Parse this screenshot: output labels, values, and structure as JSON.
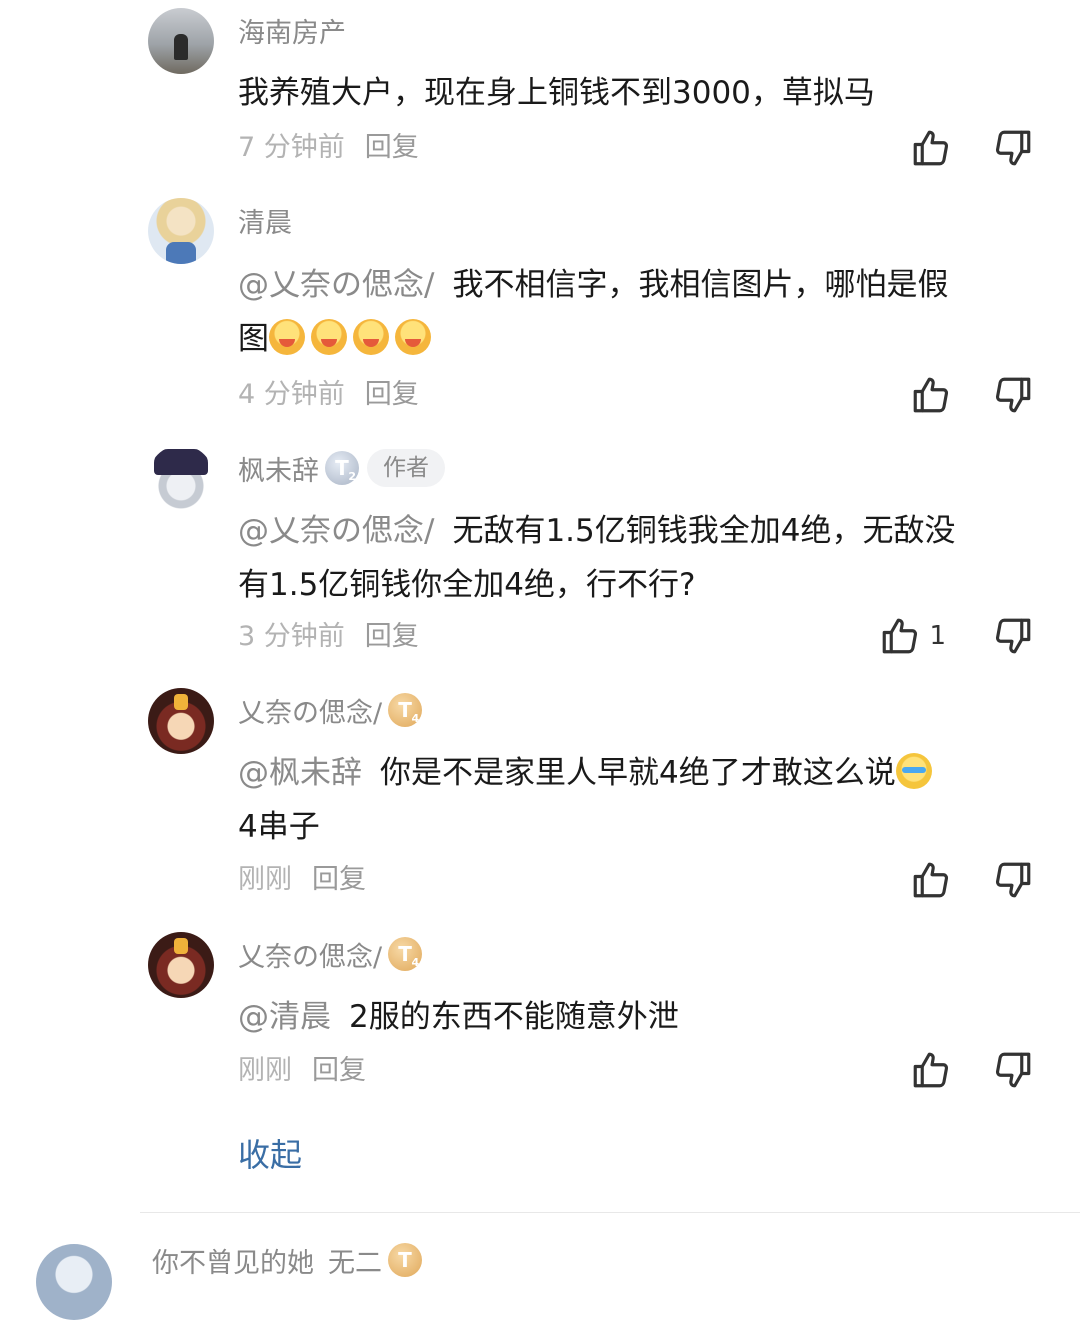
{
  "comments": [
    {
      "username": "海南房产",
      "mention": "",
      "text": "我养殖大户，现在身上铜钱不到3000，草拟马",
      "text2": "",
      "time": "7 分钟前",
      "reply": "回复",
      "likes": ""
    },
    {
      "username": "清晨",
      "mention": "@乂奈の偲念/",
      "text": "我不相信字，我相信图片，哪怕是假",
      "text2": "图",
      "time": "4 分钟前",
      "reply": "回复",
      "likes": ""
    },
    {
      "username": "枫未辞",
      "badge": "T",
      "badge_level": "2",
      "author_tag": "作者",
      "mention": "@乂奈の偲念/",
      "text": "无敌有1.5亿铜钱我全加4绝，无敌没",
      "text2": "有1.5亿铜钱你全加4绝，行不行?",
      "time": "3 分钟前",
      "reply": "回复",
      "likes": "1"
    },
    {
      "username": "乂奈の偲念/",
      "badge": "T",
      "badge_level": "4",
      "mention": "@枫未辞",
      "text": "你是不是家里人早就4绝了才敢这么说",
      "text2": "4串子",
      "time": "刚刚",
      "reply": "回复",
      "likes": ""
    },
    {
      "username": "乂奈の偲念/",
      "badge": "T",
      "badge_level": "4",
      "mention": "@清晨",
      "text": "2服的东西不能随意外泄",
      "text2": "",
      "time": "刚刚",
      "reply": "回复",
      "likes": ""
    }
  ],
  "collapse_label": "收起",
  "next_comment": {
    "username": "你不曾见的她",
    "extra": "无二",
    "badge": "T"
  }
}
